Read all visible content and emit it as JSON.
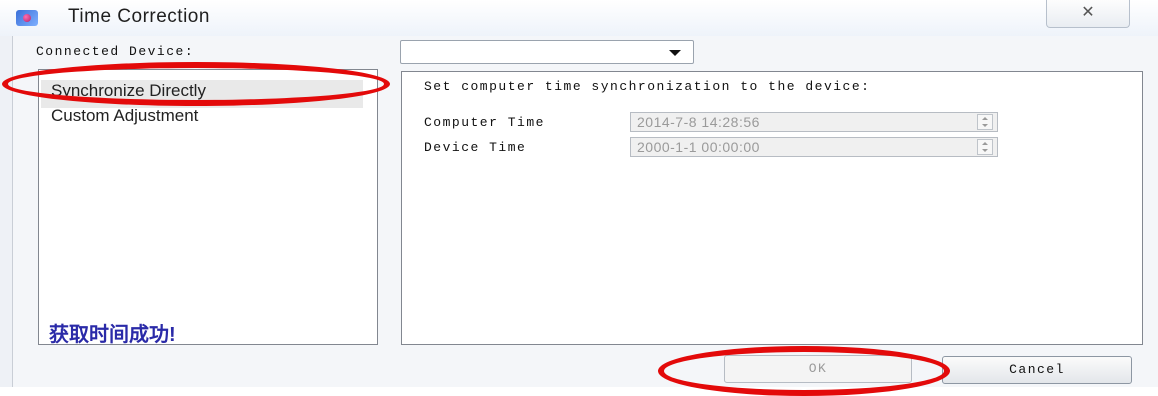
{
  "window": {
    "title": "Time Correction",
    "close_label": "✕"
  },
  "form": {
    "connected_device_label": "Connected Device:",
    "device_value": ""
  },
  "modes": {
    "items": [
      {
        "label": "Synchronize Directly",
        "selected": true
      },
      {
        "label": "Custom Adjustment",
        "selected": false
      }
    ],
    "status_message": "获取时间成功!"
  },
  "panel": {
    "description": "Set computer time synchronization to the device:",
    "computer_time_label": "Computer Time",
    "computer_time_value": "2014-7-8 14:28:56",
    "device_time_label": "Device Time",
    "device_time_value": "2000-1-1 00:00:00"
  },
  "buttons": {
    "ok_label": "OK",
    "cancel_label": "Cancel"
  },
  "colors": {
    "annotation": "#e30a0a",
    "status_text": "#2a2aa8"
  }
}
